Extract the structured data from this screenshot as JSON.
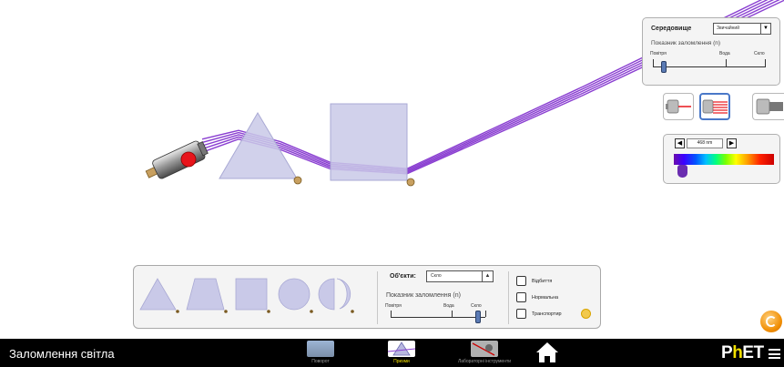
{
  "environment": {
    "title": "Середовище",
    "selected": "Звичайний",
    "ior_label": "Показник заломлення (n)",
    "scale_labels": [
      "Повітря",
      "Вода",
      "Скло"
    ]
  },
  "wavelength": {
    "value": "468 nm",
    "left_arrow": "◀",
    "right_arrow": "▶"
  },
  "objects": {
    "title": "Об'єкти:",
    "selected": "Скло",
    "ior_label": "Показник заломлення (n)",
    "scale_labels": [
      "Повітря",
      "Вода",
      "Скло"
    ],
    "checkboxes": [
      "Відбиття",
      "Нормальна",
      "Транспортир"
    ]
  },
  "select_arrow": "▲",
  "env_select_arrow": "▼",
  "navbar": {
    "title": "Заломлення світла",
    "screens": [
      {
        "label": "Поворот",
        "selected": false
      },
      {
        "label": "Призми",
        "selected": true
      },
      {
        "label": "Лабораторні інструменти",
        "selected": false
      }
    ],
    "logo_p": "P",
    "logo_h": "h",
    "logo_et": "ET"
  },
  "colors": {
    "beam": "#8a3fd1",
    "navbar_bg": "#000000",
    "selected_screen": "#f2e000",
    "shape_fill": "#c9c9e8",
    "laser_dot": "#e8141b",
    "reset": "#f08c00"
  }
}
